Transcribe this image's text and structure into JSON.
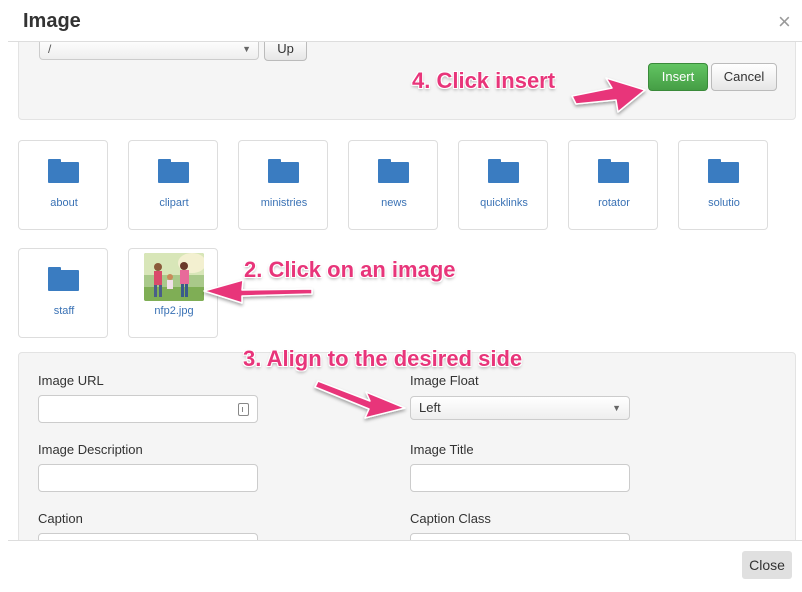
{
  "dialog": {
    "title": "Image",
    "close_glyph": "×"
  },
  "toolbar": {
    "directory_value": "/",
    "up_label": "Up",
    "insert_label": "Insert",
    "cancel_label": "Cancel"
  },
  "folders": [
    "about",
    "clipart",
    "ministries",
    "news",
    "quicklinks",
    "rotator",
    "solutio",
    "staff"
  ],
  "image_file": "nfp2.jpg",
  "form": {
    "image_url_label": "Image URL",
    "image_url_value": "",
    "image_float_label": "Image Float",
    "image_float_value": "Left",
    "image_description_label": "Image Description",
    "image_description_value": "",
    "image_title_label": "Image Title",
    "image_title_value": "",
    "caption_label": "Caption",
    "caption_class_label": "Caption Class"
  },
  "footer": {
    "close_label": "Close"
  },
  "annotations": {
    "step2": "2. Click on an image",
    "step3": "3. Align to the desired side",
    "step4": "4. Click insert",
    "color": "#e8357a"
  },
  "colors": {
    "folder": "#3a7cc1",
    "insert_button": "#459e45",
    "link_text": "#3a72b5"
  },
  "icons": {
    "folder": "folder-icon",
    "close": "close-icon",
    "select_caret": "chevron-down-icon",
    "url_picker": "file-picker-icon"
  }
}
